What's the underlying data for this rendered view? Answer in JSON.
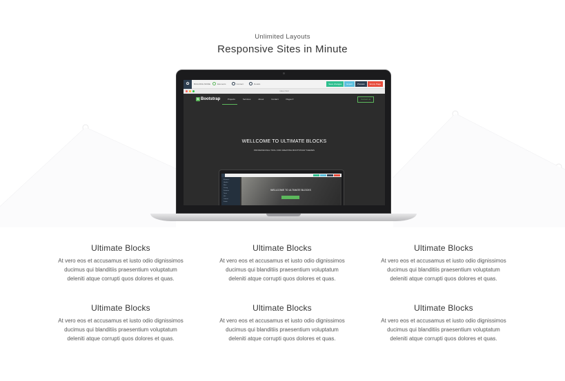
{
  "header": {
    "eyebrow": "Unlimited Layouts",
    "headline": "Responsive Sites in Minute"
  },
  "builder": {
    "app_name": "BUILDING MODE",
    "options": [
      "Elements",
      "Content",
      "Details"
    ],
    "buttons": [
      {
        "label": "Save changes",
        "color": "#2fbf8f"
      },
      {
        "label": "Export",
        "color": "#5bc0de"
      },
      {
        "label": "Preview",
        "color": "#2d3e50"
      },
      {
        "label": "Empty Page",
        "color": "#e74c3c"
      }
    ],
    "url": "index.html"
  },
  "site": {
    "brand": "Bootstrap",
    "brand_mark": "B",
    "nav_links": [
      "Projects",
      "Services",
      "About",
      "Contact",
      "Pages ▾"
    ],
    "cta": "Contact us",
    "hero_title": "WELLCOME TO ULTIMATE BLOCKS",
    "hero_sub": "PROFESSIONAL TOOL FOR CREATING BOOTSTRAP THEMES"
  },
  "nested": {
    "title": "WELLCOME TO ULTIMATE BLOCKS",
    "sidebar": [
      "Elements",
      "Header",
      "Main",
      "Pricing",
      "Features",
      "Team",
      "Info",
      "Contact",
      "Footer"
    ]
  },
  "features": [
    {
      "title": "Ultimate Blocks",
      "lines": [
        "At vero eos et accusamus et iusto odio dignissimos",
        "ducimus qui blanditiis praesentium voluptatum",
        "deleniti atque corrupti quos dolores et quas."
      ]
    },
    {
      "title": "Ultimate Blocks",
      "lines": [
        "At vero eos et accusamus et iusto odio dignissimos",
        "ducimus qui blanditiis praesentium voluptatum",
        "deleniti atque corrupti quos dolores et quas."
      ]
    },
    {
      "title": "Ultimate Blocks",
      "lines": [
        "At vero eos et accusamus et iusto odio dignissimos",
        "ducimus qui blanditiis praesentium voluptatum",
        "deleniti atque corrupti quos dolores et quas."
      ]
    },
    {
      "title": "Ultimate Blocks",
      "lines": [
        "At vero eos et accusamus et iusto odio dignissimos",
        "ducimus qui blanditiis praesentium voluptatum",
        "deleniti atque corrupti quos dolores et quas."
      ]
    },
    {
      "title": "Ultimate Blocks",
      "lines": [
        "At vero eos et accusamus et iusto odio dignissimos",
        "ducimus qui blanditiis praesentium voluptatum",
        "deleniti atque corrupti quos dolores et quas."
      ]
    },
    {
      "title": "Ultimate Blocks",
      "lines": [
        "At vero eos et accusamus et iusto odio dignissimos",
        "ducimus qui blanditiis praesentium voluptatum",
        "deleniti atque corrupti quos dolores et quas."
      ]
    }
  ],
  "colors": {
    "accent_green": "#5cb85c",
    "screen_bg": "#2c2c2c"
  }
}
